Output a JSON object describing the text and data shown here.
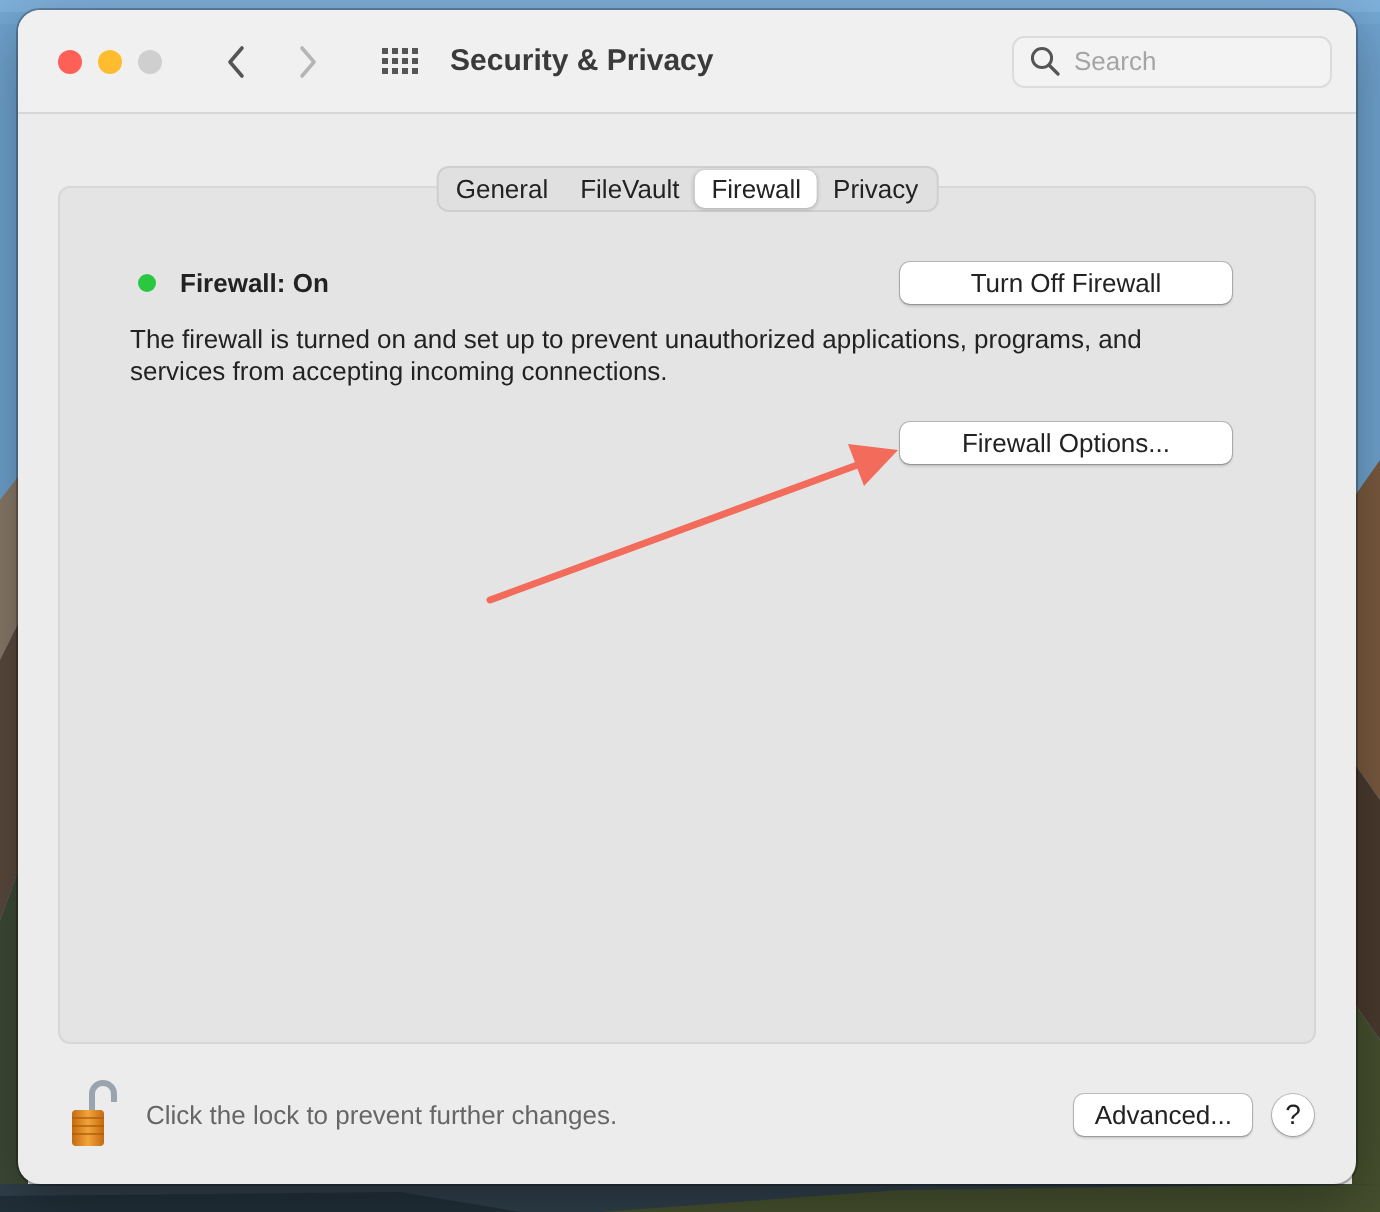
{
  "window": {
    "title": "Security & Privacy"
  },
  "nav_buttons": [
    {
      "kind": "back",
      "disabled": false
    },
    {
      "kind": "forward",
      "disabled": true
    }
  ],
  "search": {
    "placeholder": "Search"
  },
  "tabs": [
    {
      "label": "General",
      "selected": false
    },
    {
      "label": "FileVault",
      "selected": false
    },
    {
      "label": "Firewall",
      "selected": true
    },
    {
      "label": "Privacy",
      "selected": false
    }
  ],
  "firewall": {
    "status": "Firewall: On",
    "on": true,
    "toggle_button": "Turn Off Firewall",
    "description": "The firewall is turned on and set up to prevent unauthorized applications, programs, and services from accepting incoming connections.",
    "options_button": "Firewall Options..."
  },
  "footer": {
    "locked": false,
    "lock_text": "Click the lock to prevent further changes.",
    "advanced_button": "Advanced...",
    "help_button": "?"
  }
}
